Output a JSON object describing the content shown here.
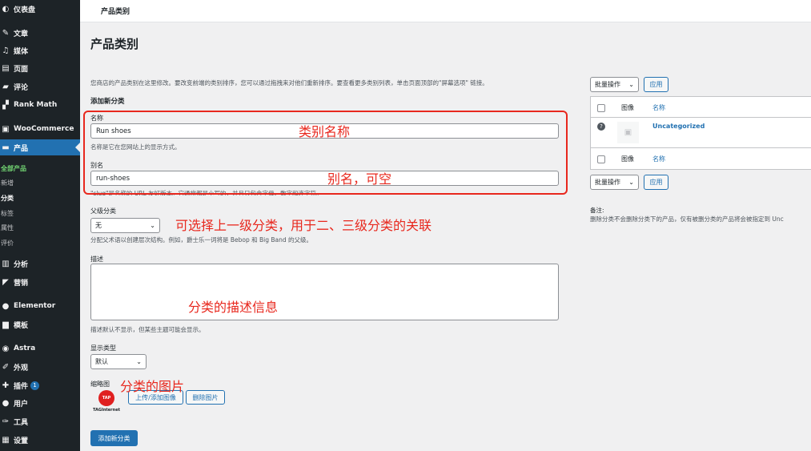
{
  "sidebar": {
    "dashboard": "仪表盘",
    "posts": "文章",
    "media": "媒体",
    "pages": "页面",
    "comments": "评论",
    "rankmath": "Rank Math",
    "woocommerce": "WooCommerce",
    "products": "产品",
    "sub_all": "全部产品",
    "sub_add": "新增",
    "sub_categories": "分类",
    "sub_tags": "标签",
    "sub_attributes": "属性",
    "sub_reviews": "评价",
    "analytics": "分析",
    "marketing": "营销",
    "elementor": "Elementor",
    "templates": "模板",
    "astra": "Astra",
    "appearance": "外观",
    "plugins": "插件",
    "plugins_badge": "1",
    "users": "用户",
    "tools": "工具",
    "settings": "设置"
  },
  "topbar": {
    "breadcrumb": "产品类别"
  },
  "page": {
    "title": "产品类别",
    "intro": "您商店的产品类别在这里修改。要改变前端的类别排序，您可以通过拖拽来对他们重新排序。要查看更多类别列表，单击页面顶部的\"屏幕选项\" 链接。",
    "add_new_title": "添加新分类"
  },
  "form": {
    "name_label": "名称",
    "name_value": "Run shoes",
    "name_help": "名称是它在您网站上的显示方式。",
    "slug_label": "别名",
    "slug_value": "run-shoes",
    "slug_help": "\"slug\"是名称的 URL 友好版本。它通常都是小写的，并且只包含字母、数字和连字符。",
    "parent_label": "父级分类",
    "parent_value": "无",
    "parent_help": "分配父术语以创建层次结构。例如，爵士乐一词将是 Bebop 和 Big Band 的父级。",
    "desc_label": "描述",
    "desc_help": "描述默认不显示，但某些主题可能会显示。",
    "display_label": "显示类型",
    "display_value": "默认",
    "thumb_label": "缩略图",
    "thumb_logo": "TAP",
    "thumb_logo_text": "TAGInternet",
    "upload_btn": "上传/添加图像",
    "remove_btn": "删除图片",
    "submit_btn": "添加新分类"
  },
  "annotations": {
    "name": "类别名称",
    "slug": "别名，可空",
    "parent": "可选择上一级分类，用于二、三级分类的关联",
    "desc": "分类的描述信息",
    "thumb": "分类的图片"
  },
  "right": {
    "bulk_label": "批量操作",
    "apply_label": "应用",
    "col_image": "图像",
    "col_name": "名称",
    "row_name": "Uncategorized",
    "note_title": "备注:",
    "note_text": "删除分类不会删除分类下的产品，仅有被删分类的产品将会被指定到 Unc"
  },
  "colors": {
    "accent": "#2271b1",
    "annotation": "#e8281e",
    "sidebar": "#1d2327"
  }
}
